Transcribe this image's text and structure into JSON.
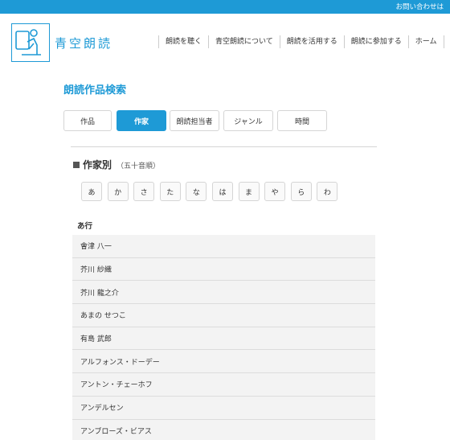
{
  "topbar": {
    "contact_label": "お問い合わせは"
  },
  "logo": {
    "text": "青空朗読"
  },
  "nav": {
    "items": [
      {
        "label": "朗読を聴く"
      },
      {
        "label": "青空朗読について"
      },
      {
        "label": "朗読を活用する"
      },
      {
        "label": "朗読に参加する"
      },
      {
        "label": "ホーム"
      }
    ]
  },
  "page": {
    "title": "朗読作品検索"
  },
  "tabs": [
    {
      "label": "作品",
      "active": false
    },
    {
      "label": "作家",
      "active": true
    },
    {
      "label": "朗読担当者",
      "active": false
    },
    {
      "label": "ジャンル",
      "active": false
    },
    {
      "label": "時間",
      "active": false
    }
  ],
  "section": {
    "heading": "作家別",
    "subheading": "（五十音順）"
  },
  "kana": [
    "あ",
    "か",
    "さ",
    "た",
    "な",
    "は",
    "ま",
    "や",
    "ら",
    "わ"
  ],
  "group": {
    "heading": "あ行"
  },
  "authors": [
    "會津 八一",
    "芥川 紗織",
    "芥川 龍之介",
    "あまの せつこ",
    "有島 武郎",
    "アルフォンス・ドーデー",
    "アントン・チェーホフ",
    "アンデルセン",
    "アンブローズ・ビアス"
  ],
  "colors": {
    "accent": "#1e9ad6",
    "row_bg": "#f3f3f3",
    "border": "#d5d5d5"
  }
}
